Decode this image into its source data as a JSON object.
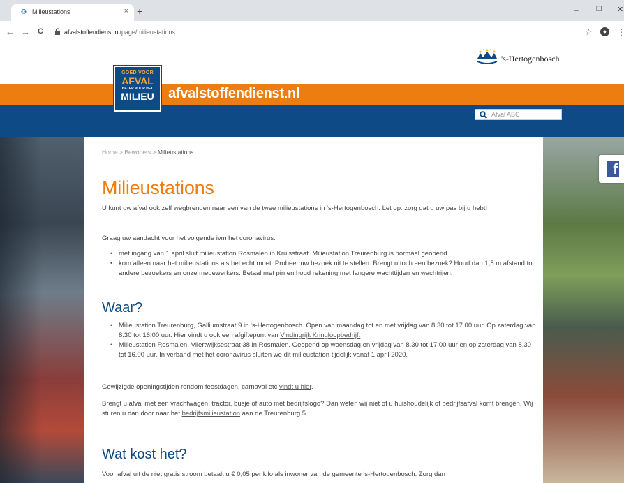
{
  "browser": {
    "tab_title": "Milieustations",
    "tab_close": "×",
    "new_tab": "+",
    "win_minimize": "–",
    "win_restore": "❐",
    "win_close": "✕",
    "back": "←",
    "forward": "→",
    "reload": "C",
    "url_domain": "afvalstoffendienst.nl",
    "url_path": "/page/milieustations",
    "bookmark": "☆",
    "account": "●",
    "menu": "⋮"
  },
  "header": {
    "city_name": "'s-Hertogenbosch",
    "badge": {
      "line1": "GOED VOOR",
      "line2": "AFVAL",
      "line3": "BETER VOOR HET",
      "line4": "MILIEU"
    },
    "site_name": "afvalstoffendienst.nl",
    "search_placeholder": "Afval ABC"
  },
  "breadcrumb": {
    "home": "Home",
    "sep1": " > ",
    "section": "Bewoners",
    "sep2": " > ",
    "current": "Milieustations"
  },
  "facebook_label": "f",
  "page": {
    "title": "Milieustations",
    "intro": "U kunt uw afval ook zelf wegbrengen naar een van de twee milieustations in 's-Hertogenbosch. Let op: zorg dat u uw pas bij u hebt!",
    "corona_lead": "Graag uw aandacht voor het volgende ivm het coronavirus:",
    "corona_items": [
      "met ingang van 1 april sluit milieustation Rosmalen in Kruisstraat. Milieustation Treurenburg is normaal geopend.",
      "kom alleen naar het milieustations als het echt moet. Probeer uw bezoek uit te stellen. Brengt u toch een bezoek? Houd dan 1,5 m afstand tot andere bezoekers en onze medewerkers. Betaal met pin en houd rekening met langere wachttijden en wachtrijen."
    ],
    "waar_heading": "Waar?",
    "waar_item1_text": "Milieustation Treurenburg, Galliumstraat 9 in 's-Hertogenbosch. Open van maandag tot en met vrijdag van 8.30 tot 17.00 uur. Op zaterdag van 8.30 tot 16.00 uur. Hier vindt u ook een afgiftepunt van ",
    "waar_item1_link": "Vindingrijk Kringloopbedrijf.",
    "waar_item2": "Milieustation Rosmalen, Vliertwijksestraat 38 in Rosmalen. Geopend op woensdag en vrijdag van 8.30 tot 17.00 uur en op zaterdag van 8.30 tot 16.00 uur. In verband met het coronavirus sluiten we dit milieustation tijdelijk vanaf 1 april 2020.",
    "holiday_text": "Gewijzigde openingstijden rondom feestdagen, carnaval etc ",
    "holiday_link": "vindt u hier",
    "holiday_end": ".",
    "company_text": "Brengt u afval met een vrachtwagen, tractor, busje of auto met bedrijfslogo? Dan weten wij niet of u huishoudelijk of bedrijfsafval komt brengen. Wij sturen u dan door naar het ",
    "company_link": "bedrijfsmilieustation",
    "company_end": " aan de Treurenburg 5.",
    "cost_heading": "Wat kost het?",
    "cost_text": "Voor afval uit de niet gratis stroom betaalt u € 0,05 per kilo als inwoner van de gemeente 's-Hertogenbosch. Zorg dan"
  },
  "colors": {
    "orange": "#ee7d11",
    "blue": "#0e4a86",
    "facebook": "#3b5998"
  }
}
